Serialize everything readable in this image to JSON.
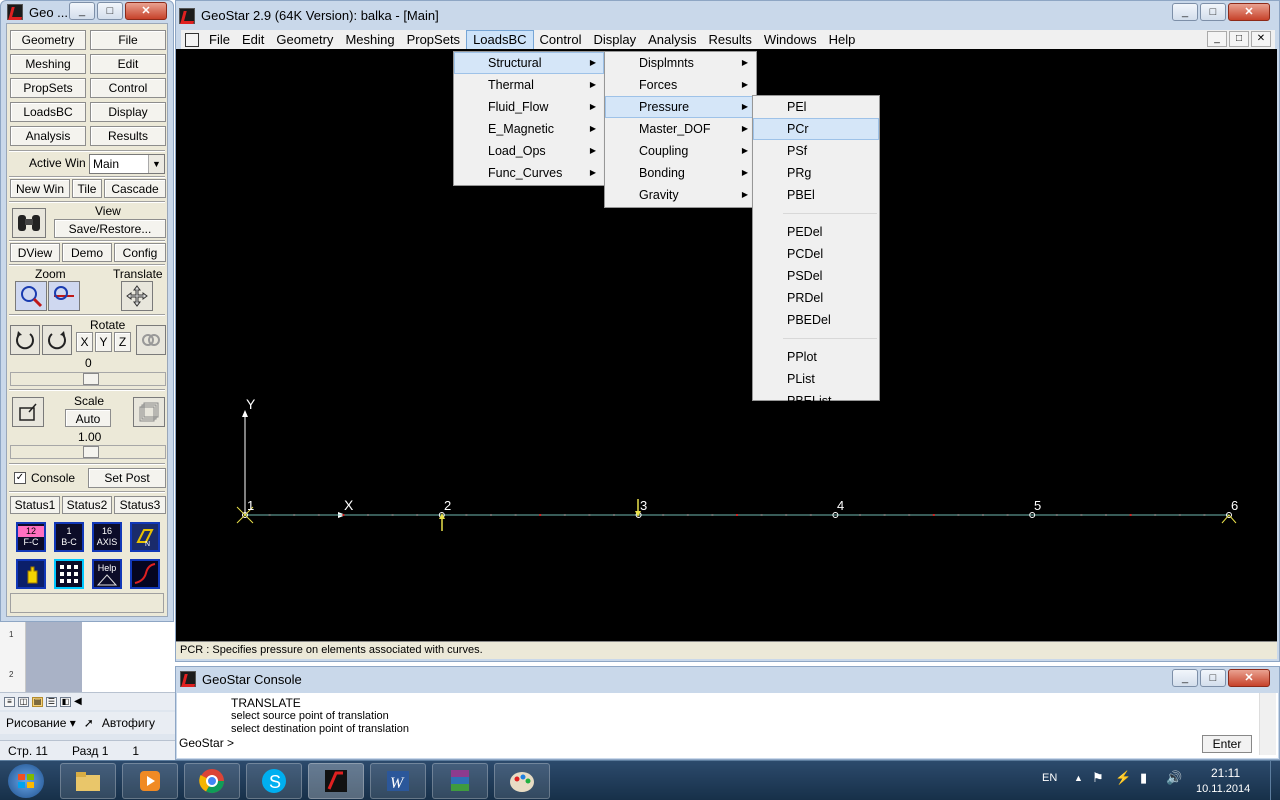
{
  "left_window": {
    "title": "Geo ...",
    "title_buttons": {
      "minimize": "_",
      "maximize": "□",
      "close": "✕"
    },
    "grid_buttons": [
      "Geometry",
      "File",
      "Meshing",
      "Edit",
      "PropSets",
      "Control",
      "LoadsBC",
      "Display",
      "Analysis",
      "Results"
    ],
    "active_win_label": "Active Win",
    "active_win_value": "Main",
    "win_buttons": [
      "New Win",
      "Tile",
      "Cascade"
    ],
    "view_label": "View",
    "save_restore": "Save/Restore...",
    "misc_buttons": [
      "DView",
      "Demo",
      "Config"
    ],
    "zoom_label": "Zoom",
    "translate_label": "Translate",
    "rotate_label": "Rotate",
    "axis_buttons": [
      "X",
      "Y",
      "Z"
    ],
    "rotate_value": "0",
    "scale_label": "Scale",
    "scale_auto": "Auto",
    "scale_value": "1.00",
    "console_label": "Console",
    "console_checked": "✓",
    "set_post": "Set Post",
    "status_tabs": [
      "Status1",
      "Status2",
      "Status3"
    ],
    "icon_labels": {
      "fc": [
        "12",
        "F-C"
      ],
      "bc": [
        "1",
        "B-C"
      ],
      "axis": [
        "16",
        "AXIS"
      ],
      "help": [
        "Help"
      ]
    }
  },
  "main_window": {
    "title": "GeoStar 2.9 (64K Version): balka - [Main]",
    "menu": [
      "File",
      "Edit",
      "Geometry",
      "Meshing",
      "PropSets",
      "LoadsBC",
      "Control",
      "Display",
      "Analysis",
      "Results",
      "Windows",
      "Help"
    ],
    "active_menu": "LoadsBC",
    "status_text": "PCR : Specifies pressure on elements associated with curves."
  },
  "menus": {
    "loadsbc": [
      "Structural",
      "Thermal",
      "Fluid_Flow",
      "E_Magnetic",
      "Load_Ops",
      "Func_Curves"
    ],
    "structural": [
      "Displmnts",
      "Forces",
      "Pressure",
      "Master_DOF",
      "Coupling",
      "Bonding",
      "Gravity"
    ],
    "pressure_group1": [
      "PEl",
      "PCr",
      "PSf",
      "PRg",
      "PBEl"
    ],
    "pressure_group2": [
      "PEDel",
      "PCDel",
      "PSDel",
      "PRDel",
      "PBEDel"
    ],
    "pressure_group3": [
      "PPlot",
      "PList",
      "PBEList"
    ],
    "highlighted": [
      "Structural",
      "Pressure",
      "PCr"
    ]
  },
  "canvas": {
    "axis_y": "Y",
    "axis_x": "X",
    "node_labels": [
      "1",
      "2",
      "3",
      "4",
      "5",
      "6"
    ],
    "colors": {
      "background": "#000000",
      "beam": "#6fb8b0",
      "node": "#ffffff",
      "support": "#e8e04a",
      "division": "#d02020"
    }
  },
  "console": {
    "title": "GeoStar Console",
    "lines": [
      "TRANSLATE",
      "select source point of translation",
      "select destination point of translation"
    ],
    "prompt": "GeoStar >",
    "enter": "Enter"
  },
  "background_app": {
    "ruler_marks": [
      "1",
      "2"
    ],
    "draw_label": "Рисование ▾",
    "autoshapes": "Автофигу",
    "page": "Стр. 11",
    "section": "Разд 1",
    "extra": "1"
  },
  "taskbar": {
    "lang": "EN",
    "time": "21:11",
    "date": "10.11.2014"
  }
}
